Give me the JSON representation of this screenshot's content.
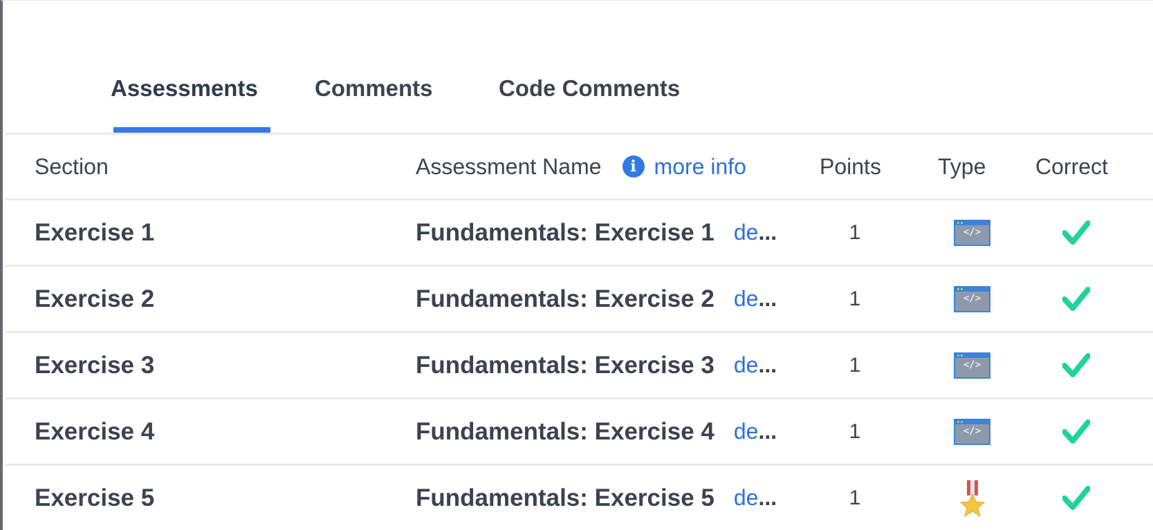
{
  "tabs": [
    {
      "label": "Assessments",
      "active": true
    },
    {
      "label": "Comments",
      "active": false
    },
    {
      "label": "Code Comments",
      "active": false
    }
  ],
  "table": {
    "headers": {
      "section": "Section",
      "assessment_name": "Assessment Name",
      "more_info": "more info",
      "points": "Points",
      "type": "Type",
      "correct": "Correct"
    },
    "rows": [
      {
        "section": "Exercise 1",
        "name": "Fundamentals: Exercise 1",
        "detail": "de",
        "ellipsis": "...",
        "points": "1",
        "type_icon": "code-window-icon",
        "correct": true
      },
      {
        "section": "Exercise 2",
        "name": "Fundamentals: Exercise 2",
        "detail": "de",
        "ellipsis": "...",
        "points": "1",
        "type_icon": "code-window-icon",
        "correct": true
      },
      {
        "section": "Exercise 3",
        "name": "Fundamentals: Exercise 3",
        "detail": "de",
        "ellipsis": "...",
        "points": "1",
        "type_icon": "code-window-icon",
        "correct": true
      },
      {
        "section": "Exercise 4",
        "name": "Fundamentals: Exercise 4",
        "detail": "de",
        "ellipsis": "...",
        "points": "1",
        "type_icon": "code-window-icon",
        "correct": true
      },
      {
        "section": "Exercise 5",
        "name": "Fundamentals: Exercise 5",
        "detail": "de",
        "ellipsis": "...",
        "points": "1",
        "type_icon": "medal-icon",
        "correct": true
      }
    ]
  },
  "colors": {
    "accent": "#3b78e7",
    "link": "#2f6fdc",
    "check": "#1fd39a",
    "text": "#3b4250"
  }
}
